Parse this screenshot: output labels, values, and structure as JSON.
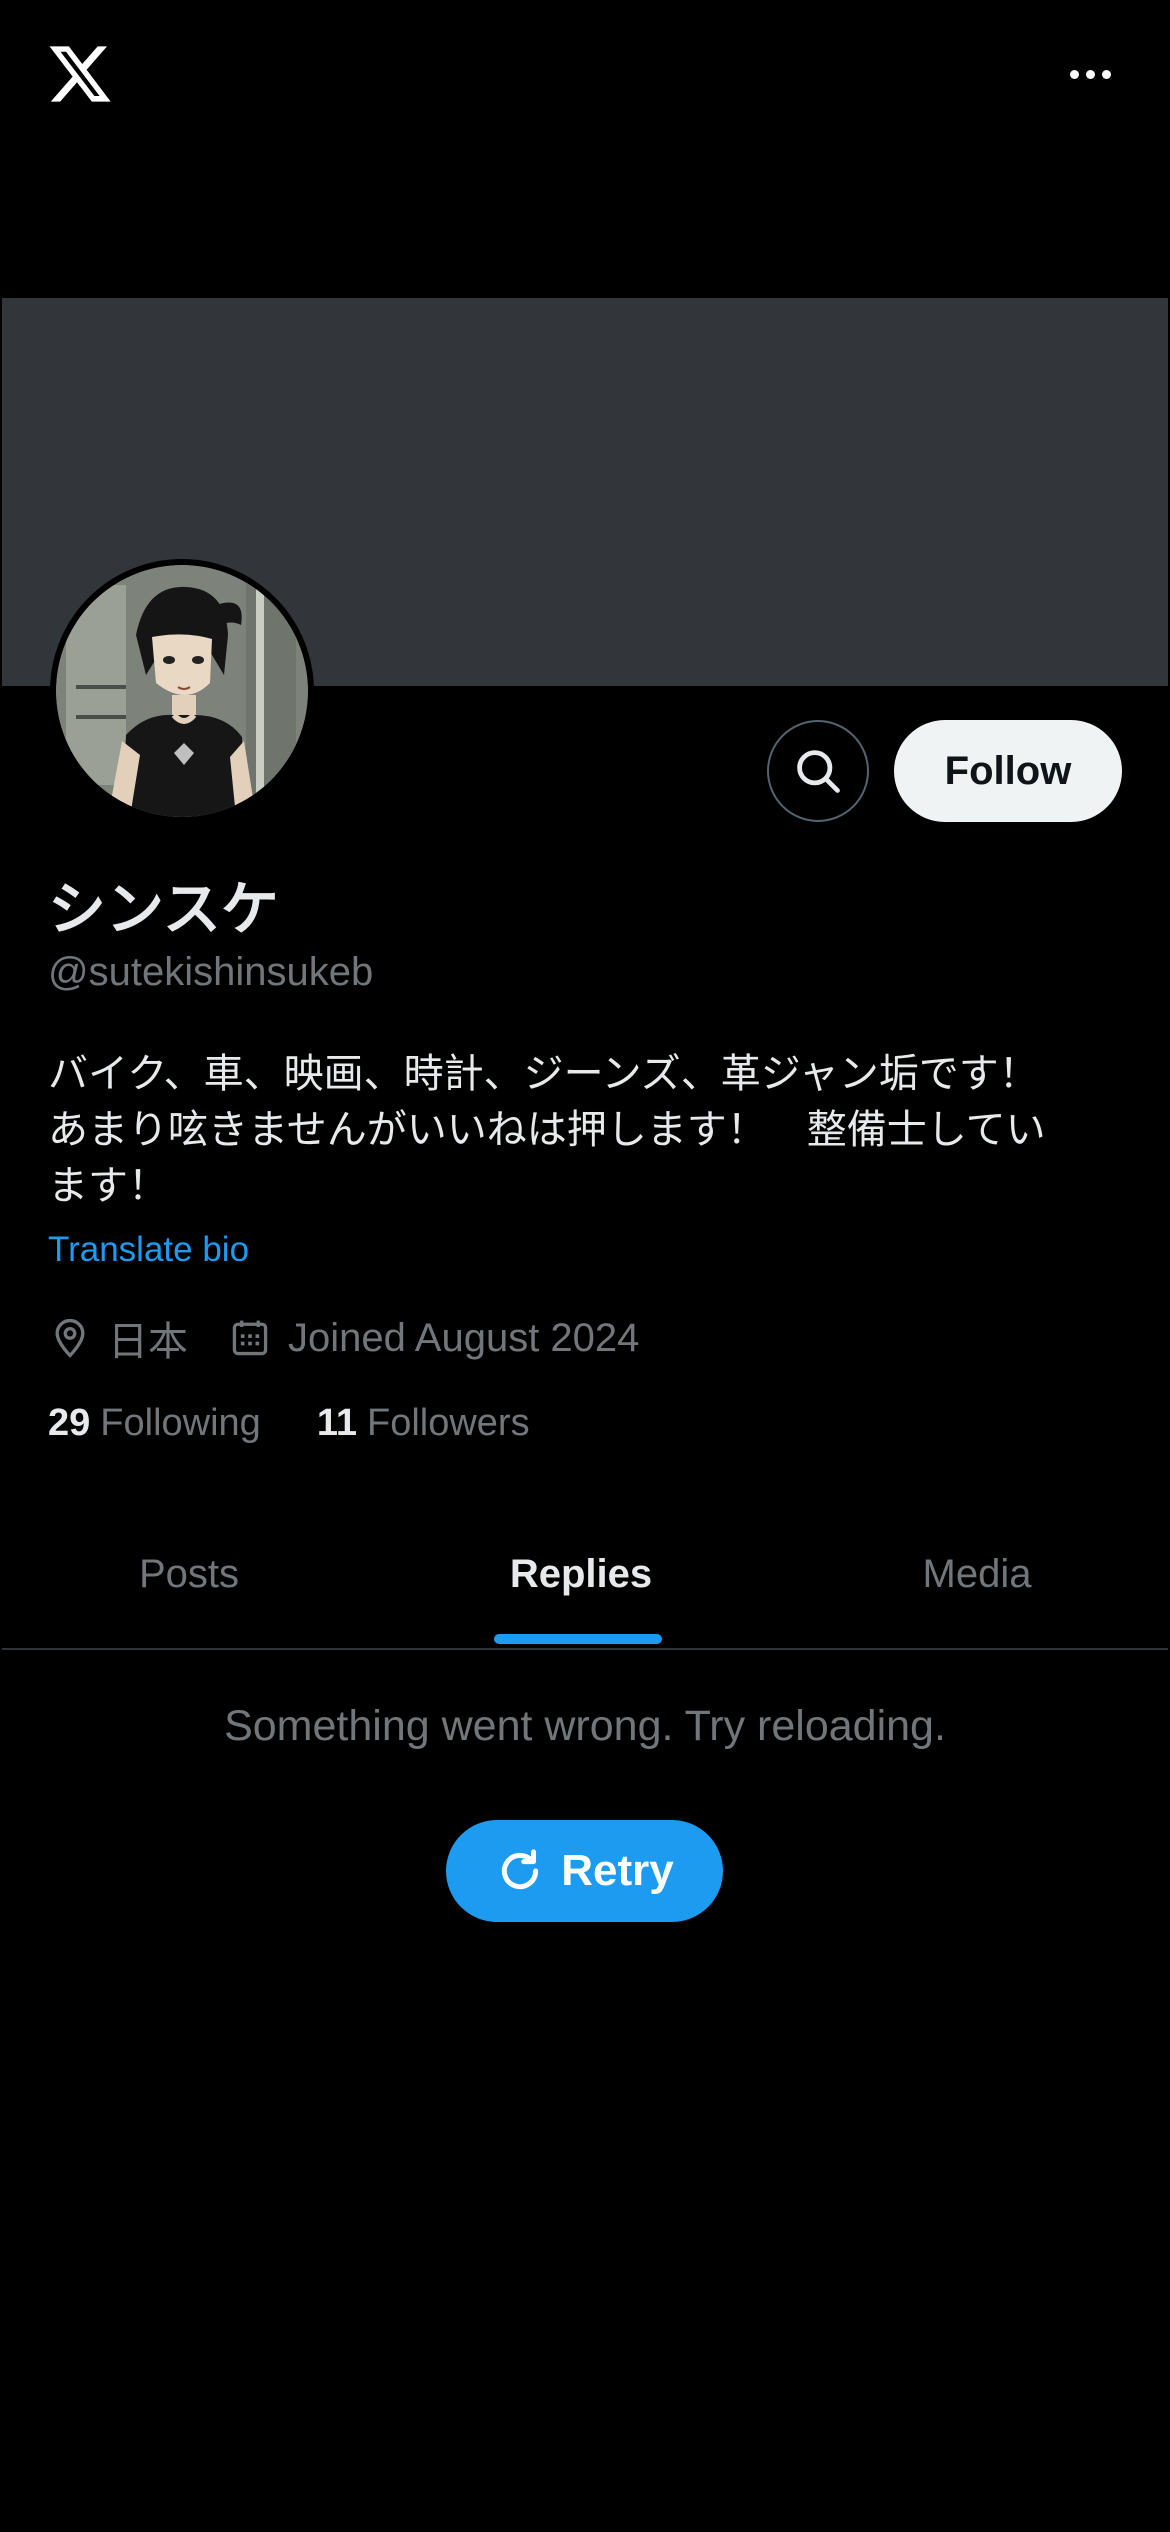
{
  "header": {
    "logo_icon": "x-logo-icon",
    "more_icon": "more-horizontal-icon"
  },
  "profile": {
    "display_name": "シンスケ",
    "handle": "@sutekishinsukeb",
    "bio": "バイク、車、映画、時計、ジーンズ、革ジャン垢です！\nあまり呟きませんがいいねは押します！　整備士してい\nます！",
    "translate_label": "Translate bio",
    "location": "日本",
    "joined": "Joined August 2024",
    "following_count": "29",
    "following_label": "Following",
    "followers_count": "11",
    "followers_label": "Followers"
  },
  "actions": {
    "search_icon": "search-icon",
    "follow_label": "Follow"
  },
  "tabs": [
    {
      "label": "Posts",
      "active": false
    },
    {
      "label": "Replies",
      "active": true
    },
    {
      "label": "Media",
      "active": false
    }
  ],
  "error": {
    "message": "Something went wrong. Try reloading.",
    "retry_label": "Retry",
    "retry_icon": "refresh-icon"
  },
  "colors": {
    "background": "#000000",
    "banner": "#32363a",
    "accent": "#1d9bf0",
    "primary_text": "#e7e9ea",
    "secondary_text": "#71767b",
    "follow_button_bg": "#eff3f4"
  }
}
